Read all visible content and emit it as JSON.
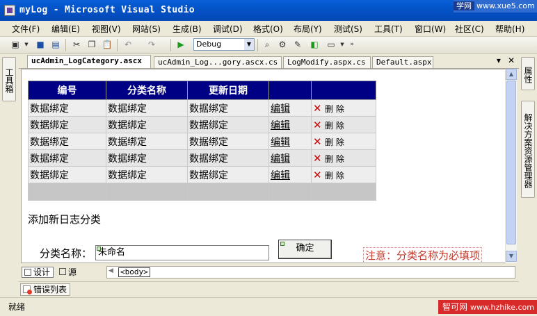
{
  "window": {
    "title": "myLog - Microsoft Visual Studio"
  },
  "watermarks": {
    "top_left": "学网",
    "top_right": "www.xue5.com",
    "bottom_left": "智可网",
    "bottom_right": "www.hzhike.com"
  },
  "menu": [
    "文件(F)",
    "编辑(E)",
    "视图(V)",
    "网站(S)",
    "生成(B)",
    "调试(D)",
    "格式(O)",
    "布局(Y)",
    "测试(S)",
    "工具(T)",
    "窗口(W)",
    "社区(C)",
    "帮助(H)"
  ],
  "toolbar": {
    "config_value": "Debug"
  },
  "left_panel": {
    "toolbox": "工具箱"
  },
  "right_panel": {
    "properties": "属性",
    "solution_explorer": "解决方案资源管理器"
  },
  "tabs": [
    {
      "label": "ucAdmin_LogCategory.ascx",
      "active": true
    },
    {
      "label": "ucAdmin_Log...gory.ascx.cs",
      "active": false
    },
    {
      "label": "LogModify.aspx.cs",
      "active": false
    },
    {
      "label": "Default.aspx",
      "active": false
    }
  ],
  "grid": {
    "headers": [
      "编号",
      "分类名称",
      "更新日期",
      "",
      ""
    ],
    "rows": [
      {
        "id": "数据绑定",
        "name": "数据绑定",
        "date": "数据绑定",
        "edit": "编辑",
        "delete": "删 除"
      },
      {
        "id": "数据绑定",
        "name": "数据绑定",
        "date": "数据绑定",
        "edit": "编辑",
        "delete": "删 除"
      },
      {
        "id": "数据绑定",
        "name": "数据绑定",
        "date": "数据绑定",
        "edit": "编辑",
        "delete": "删 除"
      },
      {
        "id": "数据绑定",
        "name": "数据绑定",
        "date": "数据绑定",
        "edit": "编辑",
        "delete": "删 除"
      },
      {
        "id": "数据绑定",
        "name": "数据绑定",
        "date": "数据绑定",
        "edit": "编辑",
        "delete": "删 除"
      }
    ]
  },
  "form": {
    "heading": "添加新日志分类",
    "name_label": "分类名称：",
    "name_value": "未命名",
    "ok_label": "确定",
    "note": "注意：分类名称为必填项"
  },
  "view_bar": {
    "design": "设计",
    "source": "源",
    "breadcrumb": "<body>"
  },
  "error_list": "错误列表",
  "status": "就绪"
}
